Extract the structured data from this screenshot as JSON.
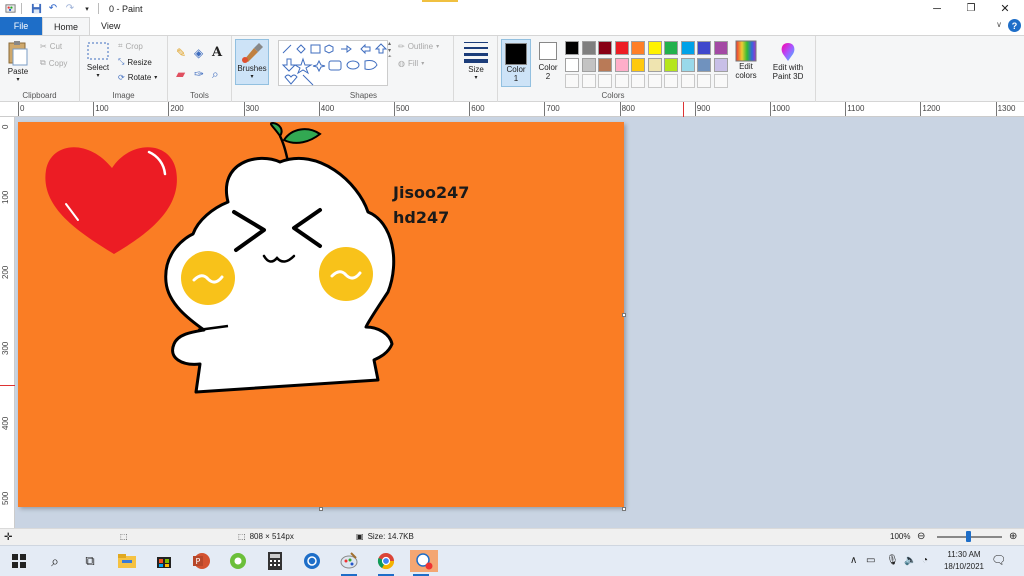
{
  "window": {
    "title": "0 - Paint",
    "buttons": {
      "minimize": "─",
      "maximize": "❐",
      "close": "✕"
    }
  },
  "tabs": {
    "file": "File",
    "home": "Home",
    "view": "View",
    "help": "?"
  },
  "ribbon": {
    "clipboard": {
      "label": "Clipboard",
      "paste": "Paste",
      "cut": "Cut",
      "copy": "Copy"
    },
    "image": {
      "label": "Image",
      "select": "Select",
      "crop": "Crop",
      "resize": "Resize",
      "rotate": "Rotate"
    },
    "tools": {
      "label": "Tools"
    },
    "brushes": {
      "label": "Brushes"
    },
    "shapes": {
      "label": "Shapes",
      "outline": "Outline",
      "fill": "Fill"
    },
    "size": {
      "label": "Size"
    },
    "colors": {
      "label": "Colors",
      "color1": {
        "line1": "Color",
        "line2": "1",
        "value": "#000000"
      },
      "color2": {
        "line1": "Color",
        "line2": "2",
        "value": "#ffffff"
      },
      "palette_row1": [
        "#000000",
        "#7f7f7f",
        "#880015",
        "#ed1c24",
        "#ff7f27",
        "#fff200",
        "#22b14c",
        "#00a2e8",
        "#3f48cc",
        "#a349a4"
      ],
      "palette_row2": [
        "#ffffff",
        "#c3c3c3",
        "#b97a57",
        "#ffaec9",
        "#ffc90e",
        "#efe4b0",
        "#b5e61d",
        "#99d9ea",
        "#7092be",
        "#c8bfe7"
      ],
      "edit_colors": {
        "line1": "Edit",
        "line2": "colors"
      },
      "paint3d": {
        "line1": "Edit with",
        "line2": "Paint 3D"
      }
    }
  },
  "ruler": {
    "h_ticks": [
      "0",
      "100",
      "200",
      "300",
      "400",
      "500",
      "600",
      "700",
      "800",
      "900",
      "1000",
      "1100",
      "1200",
      "1300"
    ],
    "v_ticks": [
      "0",
      "100",
      "200",
      "300",
      "400",
      "500"
    ]
  },
  "canvas": {
    "background": "#fa7d24",
    "text_line1": "Jisoo247",
    "text_line2": "hd247"
  },
  "status": {
    "dimensions": "808 × 514px",
    "size": "Size: 14.7KB",
    "zoom": "100%"
  },
  "taskbar": {
    "time": "11:30 AM",
    "date": "18/10/2021"
  }
}
